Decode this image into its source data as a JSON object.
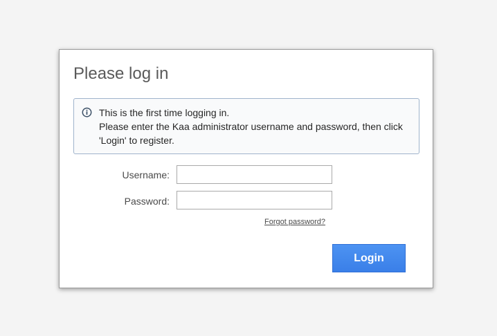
{
  "dialog": {
    "title": "Please log in",
    "info": {
      "icon": "info-circle-icon",
      "line1": "This is the first time logging in.",
      "line2": "Please enter the Kaa administrator username and password, then click",
      "line3": "'Login' to register."
    },
    "form": {
      "username_label": "Username:",
      "username_value": "",
      "password_label": "Password:",
      "password_value": "",
      "forgot_link": "Forgot password?",
      "login_button": "Login"
    }
  },
  "colors": {
    "background": "#f4f4f4",
    "login_button": "#4389f0",
    "info_border": "#9fb3cb"
  }
}
